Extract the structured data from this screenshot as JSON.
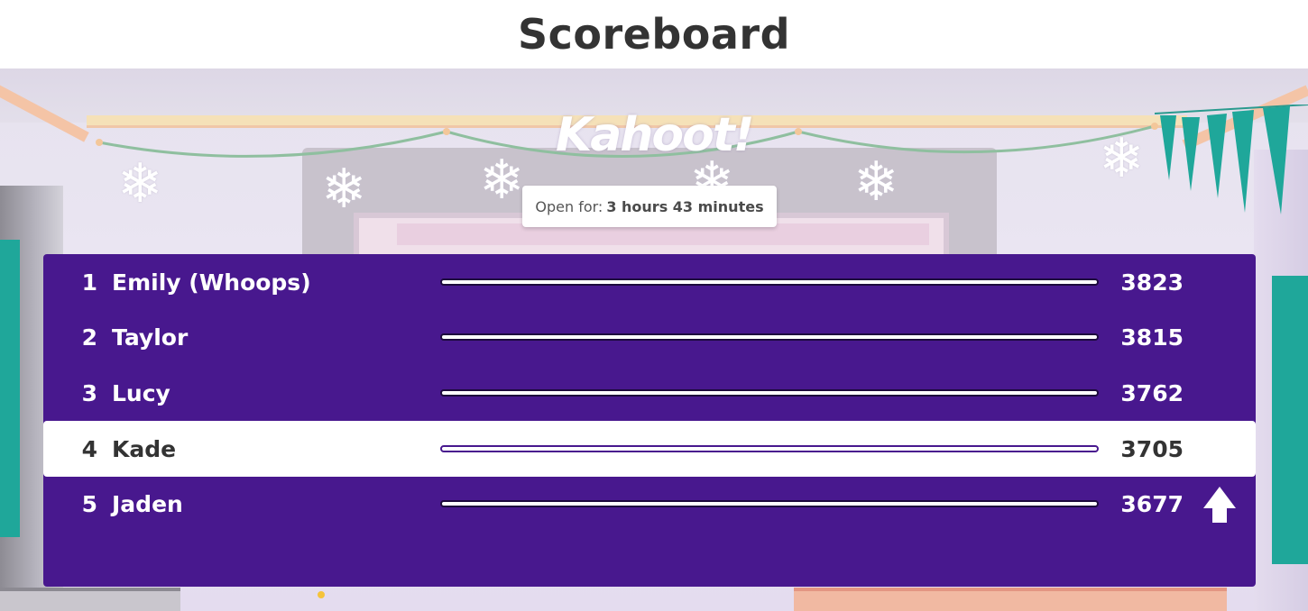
{
  "header": {
    "title": "Scoreboard"
  },
  "game": {
    "logo_text": "Kahoot!"
  },
  "status": {
    "open_prefix": "Open for:",
    "open_duration": "3 hours 43 minutes"
  },
  "leaderboard": {
    "rows": [
      {
        "rank": "1",
        "name": "Emily (Whoops)",
        "score": "3823"
      },
      {
        "rank": "2",
        "name": "Taylor",
        "score": "3815"
      },
      {
        "rank": "3",
        "name": "Lucy",
        "score": "3762"
      },
      {
        "rank": "4",
        "name": "Kade",
        "score": "3705"
      },
      {
        "rank": "5",
        "name": "Jaden",
        "score": "3677"
      }
    ],
    "highlighted_rank": "4",
    "trend_icon": "arrow-up-icon"
  },
  "colors": {
    "panel": "#48188e",
    "highlight": "#ffffff",
    "text_light": "#ffffff",
    "text_dark": "#333333"
  }
}
